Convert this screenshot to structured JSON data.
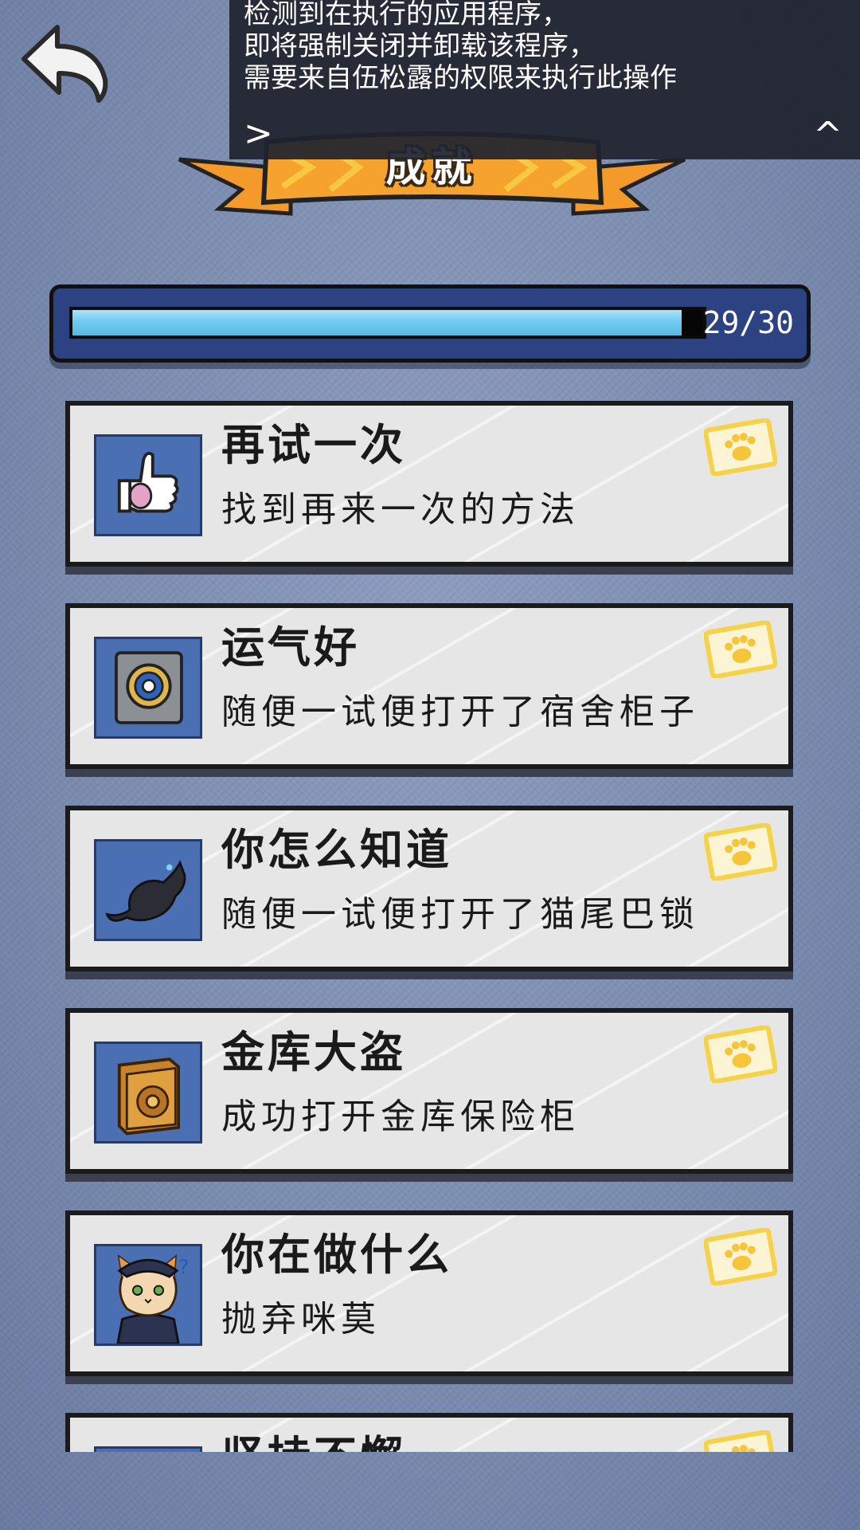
{
  "notification": {
    "lines": [
      "检测到在执行的应用程序，",
      "即将强制关闭并卸载该程序，",
      "需要来自伍松露的权限来执行此操作"
    ],
    "expand_label": ">",
    "collapse_label": "^"
  },
  "header": {
    "title": "成就",
    "back_icon": "back-arrow-icon"
  },
  "progress": {
    "label": "29/30",
    "fraction": 0.966
  },
  "achievements": [
    {
      "title": "再试一次",
      "desc": "找到再来一次的方法",
      "icon": "thumbs-up-icon"
    },
    {
      "title": "运气好",
      "desc": "随便一试便打开了宿舍柜子",
      "icon": "safe-lock-icon"
    },
    {
      "title": "你怎么知道",
      "desc": "随便一试便打开了猫尾巴锁",
      "icon": "cat-tail-lock-icon"
    },
    {
      "title": "金库大盗",
      "desc": "成功打开金库保险柜",
      "icon": "vault-icon"
    },
    {
      "title": "你在做什么",
      "desc": "抛弃咪莫",
      "icon": "cat-officer-icon"
    },
    {
      "title": "坚持不懈",
      "desc": "",
      "icon": "achievement-icon"
    }
  ],
  "colors": {
    "background": "#7b8cb0",
    "banner": "#f39a2a",
    "progress_fill": "#6fcbef",
    "card": "#e6e6e6",
    "stamp": "#f6d24a"
  }
}
